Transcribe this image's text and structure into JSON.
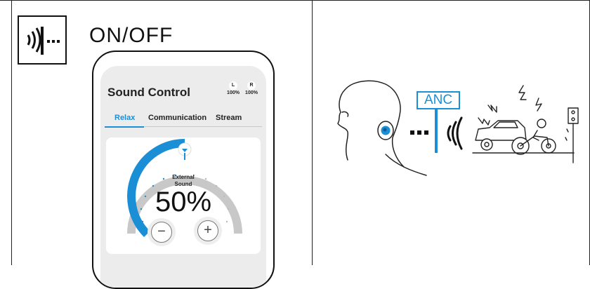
{
  "panel_left": {
    "icon": "ambient-sound-toggle-icon",
    "heading": "ON/OFF"
  },
  "app": {
    "title": "Sound Control",
    "battery": {
      "left": {
        "side": "L",
        "level": "100%"
      },
      "right": {
        "side": "R",
        "level": "100%"
      }
    },
    "tabs": [
      {
        "label": "Relax",
        "active": true
      },
      {
        "label": "Communication",
        "active": false
      },
      {
        "label": "Stream",
        "active": false
      }
    ],
    "dial": {
      "label_line1": "External",
      "label_line2": "Sound",
      "value": "50%",
      "level_fraction": 0.5,
      "minus_label": "−",
      "plus_label": "+"
    }
  },
  "panel_right": {
    "anc_label": "ANC",
    "illustration": "person-with-earbud-blocking-traffic-noise"
  },
  "colors": {
    "accent": "#1a8fd6",
    "dial_track": "#c8c8c8",
    "line": "#111111"
  }
}
